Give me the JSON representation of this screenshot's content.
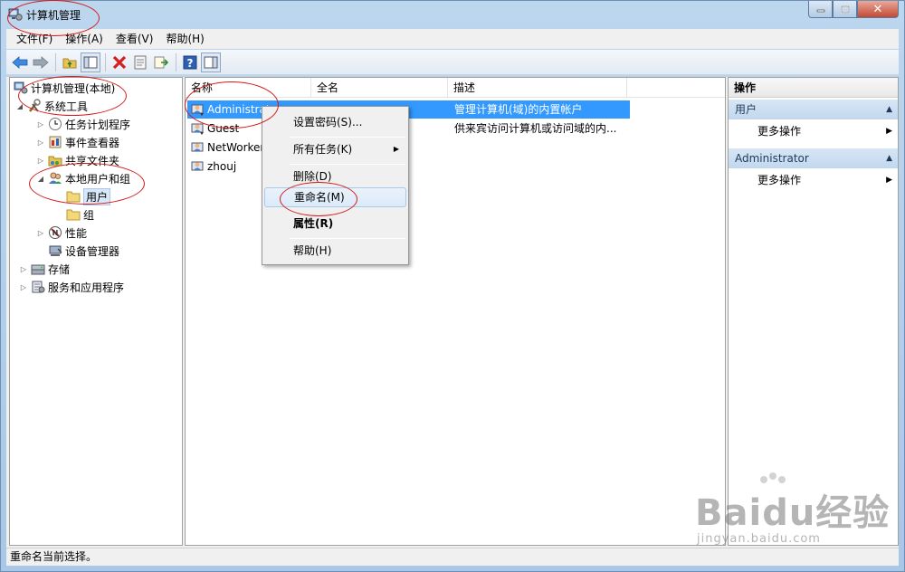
{
  "window": {
    "title": "计算机管理",
    "close_glyph": "✕"
  },
  "menubar": {
    "items": [
      "文件(F)",
      "操作(A)",
      "查看(V)",
      "帮助(H)"
    ]
  },
  "tree": {
    "items": [
      {
        "label": "计算机管理(本地)",
        "arrow": ""
      },
      {
        "label": "系统工具",
        "arrow": "◢"
      },
      {
        "label": "任务计划程序",
        "arrow": "▷"
      },
      {
        "label": "事件查看器",
        "arrow": "▷"
      },
      {
        "label": "共享文件夹",
        "arrow": "▷"
      },
      {
        "label": "本地用户和组",
        "arrow": "◢"
      },
      {
        "label": "用户",
        "arrow": ""
      },
      {
        "label": "组",
        "arrow": ""
      },
      {
        "label": "性能",
        "arrow": "▷"
      },
      {
        "label": "设备管理器",
        "arrow": ""
      },
      {
        "label": "存储",
        "arrow": "▷"
      },
      {
        "label": "服务和应用程序",
        "arrow": "▷"
      }
    ]
  },
  "list": {
    "columns": [
      "名称",
      "全名",
      "描述"
    ],
    "rows": [
      {
        "name": "Administrator",
        "fullname": "",
        "description": "管理计算机(域)的内置帐户"
      },
      {
        "name": "Guest",
        "fullname": "",
        "description": "供来宾访问计算机或访问域的内..."
      },
      {
        "name": "NetWorker",
        "fullname": "",
        "description": ""
      },
      {
        "name": "zhouj",
        "fullname": "",
        "description": ""
      }
    ]
  },
  "context_menu": {
    "items": [
      "设置密码(S)...",
      "所有任务(K)",
      "删除(D)",
      "重命名(M)",
      "属性(R)",
      "帮助(H)"
    ],
    "submenu_arrow": "▶"
  },
  "actions": {
    "title": "操作",
    "groups": [
      {
        "label": "用户",
        "item": "更多操作"
      },
      {
        "label": "Administrator",
        "item": "更多操作"
      }
    ],
    "collapse_glyph": "▲",
    "more_glyph": "▶"
  },
  "statusbar": {
    "text": "重命名当前选择。"
  },
  "watermark": {
    "brand": "Baidu经验",
    "url": "jingyan.baidu.com"
  },
  "colors": {
    "selection": "#3399ff",
    "annotation": "#d41b1b"
  }
}
